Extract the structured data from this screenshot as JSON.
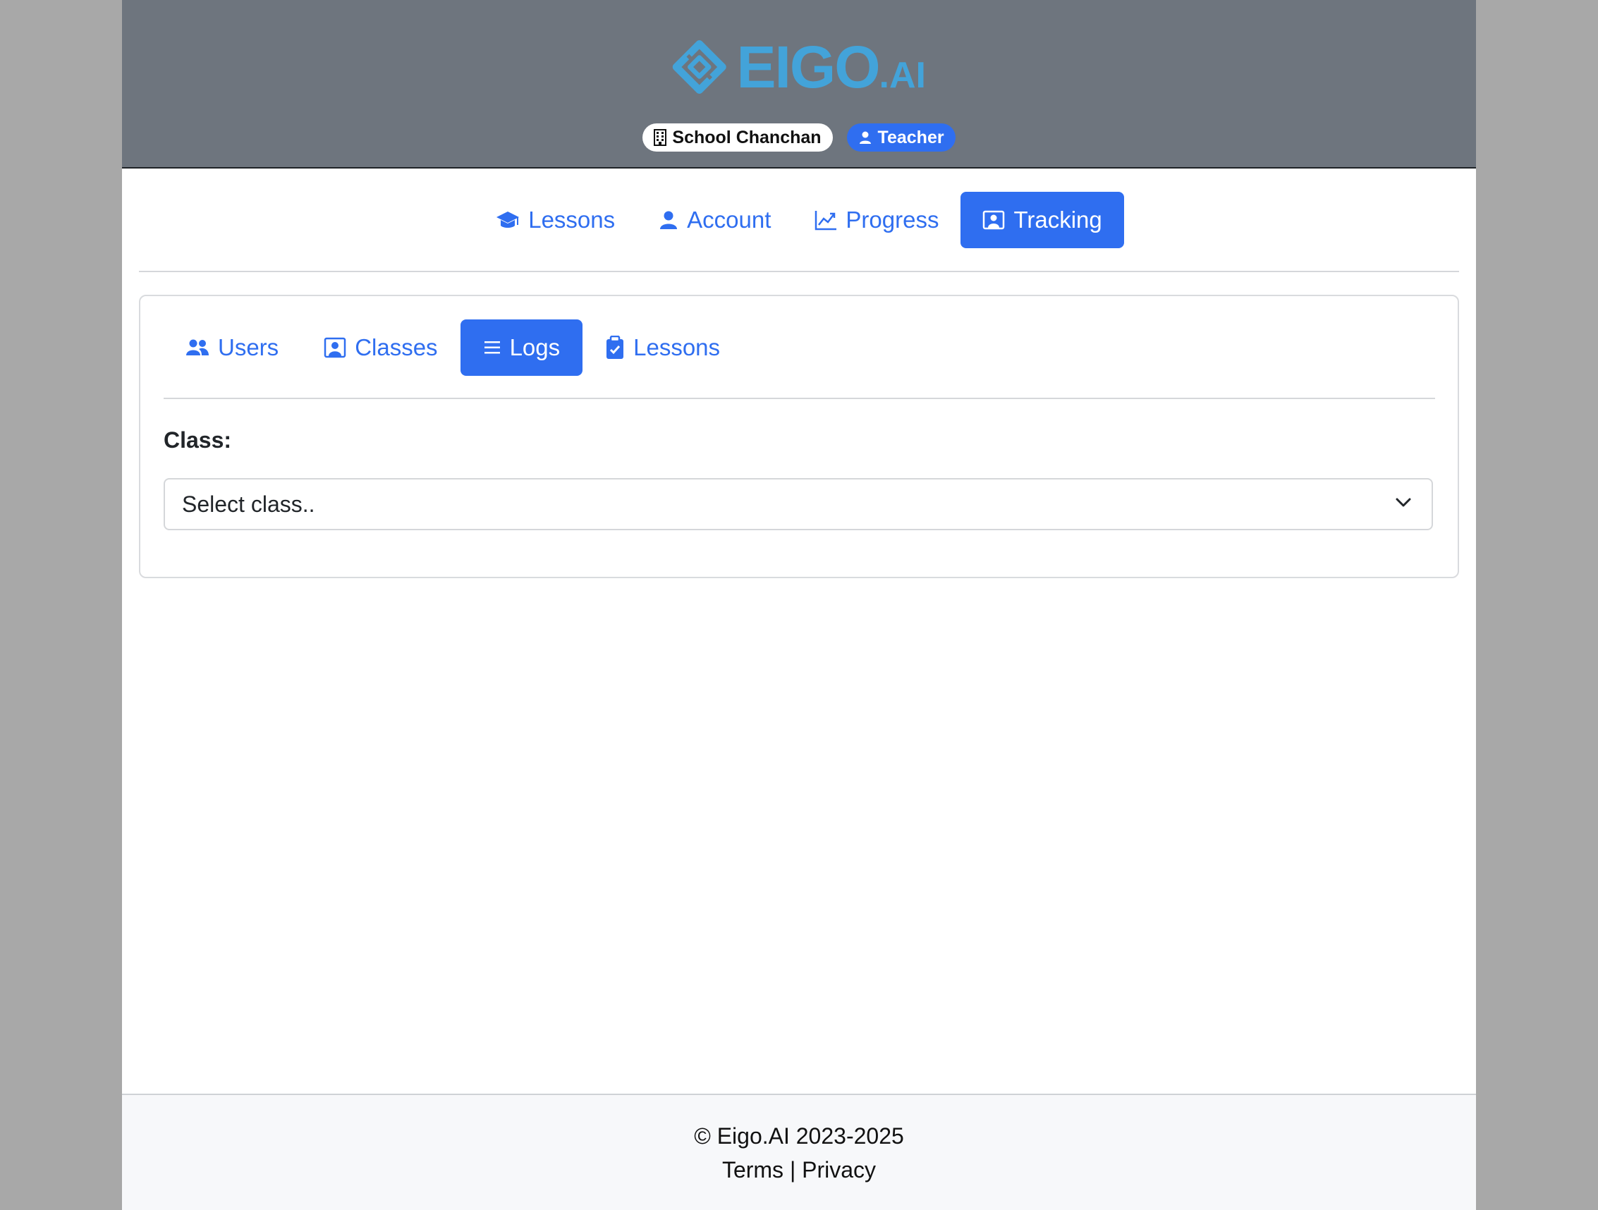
{
  "brand": {
    "name_main": "EIGO",
    "name_suffix": ".AI",
    "logo_color": "#43a3d9"
  },
  "header": {
    "school_badge": "School Chanchan",
    "school_icon": "building-icon",
    "role_badge": "Teacher",
    "role_icon": "person-icon"
  },
  "main_nav": {
    "items": [
      {
        "label": "Lessons",
        "icon": "graduation-cap-icon",
        "active": false
      },
      {
        "label": "Account",
        "icon": "person-icon",
        "active": false
      },
      {
        "label": "Progress",
        "icon": "line-chart-icon",
        "active": false
      },
      {
        "label": "Tracking",
        "icon": "person-badge-icon",
        "active": true
      }
    ]
  },
  "sub_nav": {
    "items": [
      {
        "label": "Users",
        "icon": "people-icon",
        "active": false
      },
      {
        "label": "Classes",
        "icon": "person-board-icon",
        "active": false
      },
      {
        "label": "Logs",
        "icon": "list-icon",
        "active": true
      },
      {
        "label": "Lessons",
        "icon": "clipboard-check-icon",
        "active": false
      }
    ]
  },
  "filter": {
    "class_label": "Class:",
    "class_select_value": "Select class.."
  },
  "footer": {
    "copyright": "© Eigo.AI 2023-2025",
    "terms": "Terms",
    "separator": "|",
    "privacy": "Privacy"
  },
  "colors": {
    "accent": "#2f6ef0",
    "header_bg": "#6e757e",
    "footer_bg": "#f7f8fa"
  }
}
